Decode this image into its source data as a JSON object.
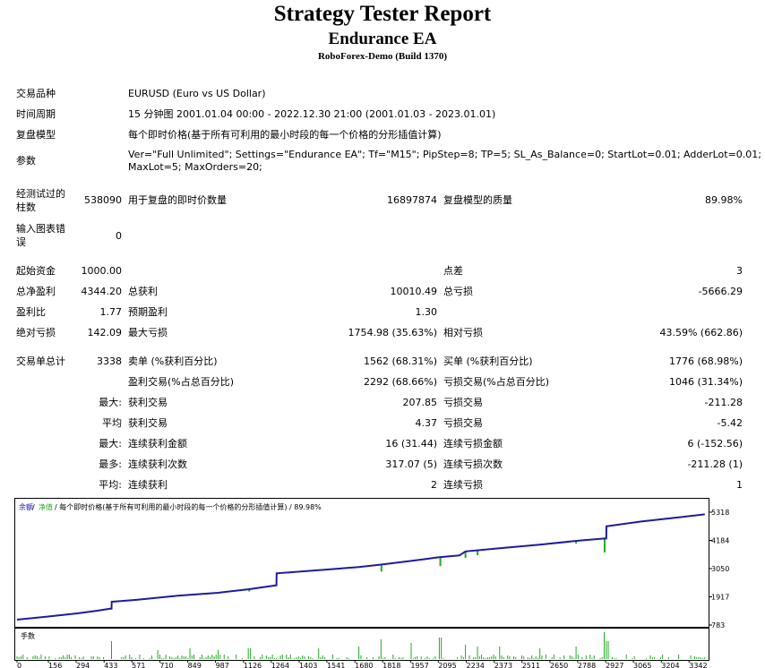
{
  "header": {
    "title": "Strategy Tester Report",
    "ea_name": "Endurance EA",
    "server": "RoboForex-Demo (Build 1370)"
  },
  "info": {
    "symbol_label": "交易品种",
    "symbol_value": "EURUSD (Euro vs US Dollar)",
    "period_label": "时间周期",
    "period_value": "15 分钟图 2001.01.04 00:00 - 2022.12.30 21:00 (2001.01.03 - 2023.01.01)",
    "model_label": "复盘模型",
    "model_value": "每个即时价格(基于所有可利用的最小时段的每一个价格的分形插值计算)",
    "params_label": "参数",
    "params_line1": "Ver=\"Full Unlimited\"; Settings=\"Endurance EA\"; Tf=\"M15\"; PipStep=8; TP=5; SL_As_Balance=0; StartLot=0.01; AdderLot=0.01;",
    "params_line2": "MaxLot=5; MaxOrders=20;"
  },
  "stats1": {
    "bars_label_1": "经测试过的",
    "bars_label_2": "柱数",
    "bars_value": "538090",
    "ticks_label": "用于复盘的即时价数量",
    "ticks_value": "16897874",
    "quality_label": "复盘模型的质量",
    "quality_value": "89.98%",
    "errors_label_1": "输入图表错",
    "errors_label_2": "误",
    "errors_value": "0"
  },
  "stats2": {
    "deposit_label": "起始资金",
    "deposit_value": "1000.00",
    "spread_label": "点差",
    "spread_value": "3",
    "net_label": "总净盈利",
    "net_value": "4344.20",
    "gross_profit_label": "总获利",
    "gross_profit_value": "10010.49",
    "gross_loss_label": "总亏损",
    "gross_loss_value": "-5666.29",
    "pf_label": "盈利比",
    "pf_value": "1.77",
    "payoff_label": "预期盈利",
    "payoff_value": "1.30",
    "abs_dd_label": "绝对亏损",
    "abs_dd_value": "142.09",
    "max_dd_label": "最大亏损",
    "max_dd_value": "1754.98 (35.63%)",
    "rel_dd_label": "相对亏损",
    "rel_dd_value": "43.59% (662.86)"
  },
  "trades": {
    "total_label": "交易单总计",
    "total_value": "3338",
    "short_label": "卖单 (%获利百分比)",
    "short_value": "1562 (68.31%)",
    "long_label": "买单 (%获利百分比)",
    "long_value": "1776 (68.98%)",
    "win_label": "盈利交易(%占总百分比)",
    "win_value": "2292 (68.66%)",
    "loss_label": "亏损交易(%占总百分比)",
    "loss_value": "1046 (31.34%)",
    "max_label": "最大:",
    "max_win_label": "获利交易",
    "max_win_value": "207.85",
    "max_loss_label": "亏损交易",
    "max_loss_value": "-211.28",
    "avg_label": "平均",
    "avg_win_label": "获利交易",
    "avg_win_value": "4.37",
    "avg_loss_label": "亏损交易",
    "avg_loss_value": "-5.42",
    "max2_label": "最大:",
    "cons_win_amt_label": "连续获利金额",
    "cons_win_amt_value": "16 (31.44)",
    "cons_loss_amt_label": "连续亏损金额",
    "cons_loss_amt_value": "6 (-152.56)",
    "most_label": "最多:",
    "cons_win_cnt_label": "连续获利次数",
    "cons_win_cnt_value": "317.07 (5)",
    "cons_loss_cnt_label": "连续亏损次数",
    "cons_loss_cnt_value": "-211.28 (1)",
    "avg2_label": "平均:",
    "cons_win_label": "连续获利",
    "cons_win_value": "2",
    "cons_loss_label": "连续亏损",
    "cons_loss_value": "1"
  },
  "chart_data": {
    "type": "line",
    "legend_balance": "余额",
    "legend_equity": "净值",
    "legend_rest": "/ 每个即时价格(基于所有可利用的最小时段的每一个价格的分形插值计算) / 89.98%",
    "volume_label": "手数",
    "colors": {
      "balance": "#1c1c9c",
      "equity": "#22aa22",
      "volume": "#22aa22"
    },
    "y_ticks": [
      5318,
      4184,
      3050,
      1917,
      783
    ],
    "ylim": [
      783,
      5600
    ],
    "x_ticks": [
      0,
      156,
      294,
      433,
      571,
      710,
      849,
      987,
      1126,
      1264,
      1403,
      1541,
      1680,
      1818,
      1957,
      2095,
      2234,
      2373,
      2511,
      2650,
      2788,
      2927,
      3065,
      3204,
      3342
    ],
    "xlim": [
      0,
      3430
    ],
    "series": [
      {
        "name": "余额",
        "x": [
          0,
          150,
          300,
          400,
          470,
          471,
          600,
          800,
          1000,
          1150,
          1290,
          1291,
          1500,
          1700,
          1820,
          2000,
          2100,
          2200,
          2230,
          2400,
          2600,
          2800,
          2920,
          2930,
          2931,
          3100,
          3300,
          3420
        ],
        "values": [
          1000,
          1120,
          1250,
          1360,
          1450,
          1720,
          1800,
          1960,
          2080,
          2220,
          2380,
          2860,
          2990,
          3110,
          3220,
          3400,
          3510,
          3580,
          3740,
          3870,
          4010,
          4180,
          4260,
          4260,
          4750,
          4940,
          5120,
          5230
        ]
      }
    ],
    "equity_dips": [
      {
        "x": 470,
        "value": 1400
      },
      {
        "x": 1155,
        "value": 2130
      },
      {
        "x": 1812,
        "value": 2930
      },
      {
        "x": 2105,
        "value": 3150
      },
      {
        "x": 2230,
        "value": 3480
      },
      {
        "x": 2290,
        "value": 3590
      },
      {
        "x": 2780,
        "value": 4060
      },
      {
        "x": 2922,
        "value": 3700
      }
    ]
  }
}
